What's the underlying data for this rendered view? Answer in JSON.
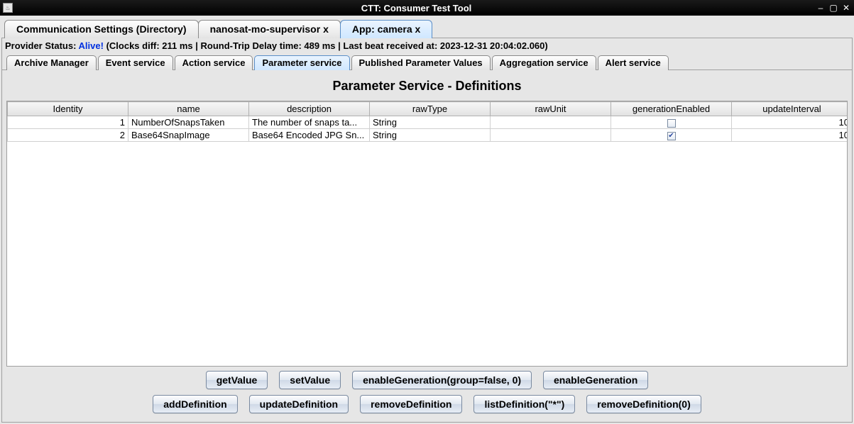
{
  "window": {
    "title": "CTT: Consumer Test Tool"
  },
  "outer_tabs": [
    {
      "label": "Communication Settings (Directory)",
      "active": false
    },
    {
      "label": "nanosat-mo-supervisor x",
      "active": false
    },
    {
      "label": "App: camera x",
      "active": true
    }
  ],
  "status": {
    "prefix": "Provider Status: ",
    "alive": "Alive!",
    "rest": " (Clocks diff: 211 ms | Round-Trip Delay time: 489 ms | Last beat received at: 2023-12-31 20:04:02.060)"
  },
  "inner_tabs": [
    {
      "label": "Archive Manager",
      "active": false
    },
    {
      "label": "Event service",
      "active": false
    },
    {
      "label": "Action service",
      "active": false
    },
    {
      "label": "Parameter service",
      "active": true
    },
    {
      "label": "Published Parameter Values",
      "active": false
    },
    {
      "label": "Aggregation service",
      "active": false
    },
    {
      "label": "Alert service",
      "active": false
    }
  ],
  "pane": {
    "title": "Parameter Service - Definitions",
    "columns": [
      "Identity",
      "name",
      "description",
      "rawType",
      "rawUnit",
      "generationEnabled",
      "updateInterval"
    ],
    "rows": [
      {
        "identity": "1",
        "name": "NumberOfSnapsTaken",
        "description": "The number of snaps ta...",
        "rawType": "String",
        "rawUnit": "",
        "generationEnabled": false,
        "updateInterval": "10"
      },
      {
        "identity": "2",
        "name": "Base64SnapImage",
        "description": "Base64 Encoded JPG Sn...",
        "rawType": "String",
        "rawUnit": "",
        "generationEnabled": true,
        "updateInterval": "10"
      }
    ]
  },
  "buttons_row1": [
    "getValue",
    "setValue",
    "enableGeneration(group=false, 0)",
    "enableGeneration"
  ],
  "buttons_row2": [
    "addDefinition",
    "updateDefinition",
    "removeDefinition",
    "listDefinition(\"*\")",
    "removeDefinition(0)"
  ]
}
